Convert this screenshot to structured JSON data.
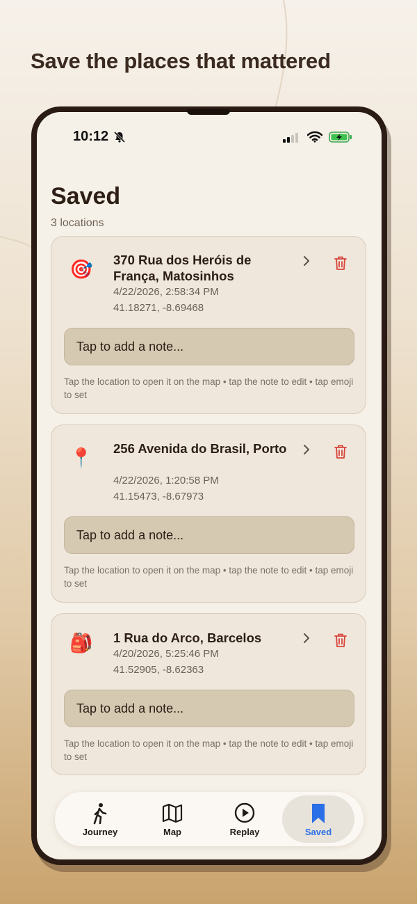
{
  "headline": "Save the places that mattered",
  "status": {
    "time": "10:12"
  },
  "page": {
    "title": "Saved",
    "count": "3 locations"
  },
  "cards": [
    {
      "emoji": "🎯",
      "address": "370 Rua dos Heróis de França, Matosinhos",
      "date": "4/22/2026, 2:58:34 PM",
      "coords": "41.18271, -8.69468",
      "note_placeholder": "Tap to add a note...",
      "hint": "Tap the location to open it on the map • tap the note to edit • tap emoji to set"
    },
    {
      "emoji": "📍",
      "address": "256 Avenida do Brasil, Porto",
      "date": "4/22/2026, 1:20:58 PM",
      "coords": "41.15473, -8.67973",
      "note_placeholder": "Tap to add a note...",
      "hint": "Tap the location to open it on the map • tap the note to edit • tap emoji to set"
    },
    {
      "emoji": "🎒",
      "address": "1 Rua do Arco, Barcelos",
      "date": "4/20/2026, 5:25:46 PM",
      "coords": "41.52905, -8.62363",
      "note_placeholder": "Tap to add a note...",
      "hint": "Tap the location to open it on the map • tap the note to edit • tap emoji to set"
    }
  ],
  "tabs": [
    {
      "label": "Journey",
      "icon": "walking-person-icon"
    },
    {
      "label": "Map",
      "icon": "map-icon"
    },
    {
      "label": "Replay",
      "icon": "play-circle-icon"
    },
    {
      "label": "Saved",
      "icon": "bookmark-icon",
      "active": true
    }
  ],
  "colors": {
    "accent": "#2b6fe6",
    "delete": "#d8443a",
    "card_bg": "#efe7dc",
    "note_bg": "#d6c9b2"
  }
}
